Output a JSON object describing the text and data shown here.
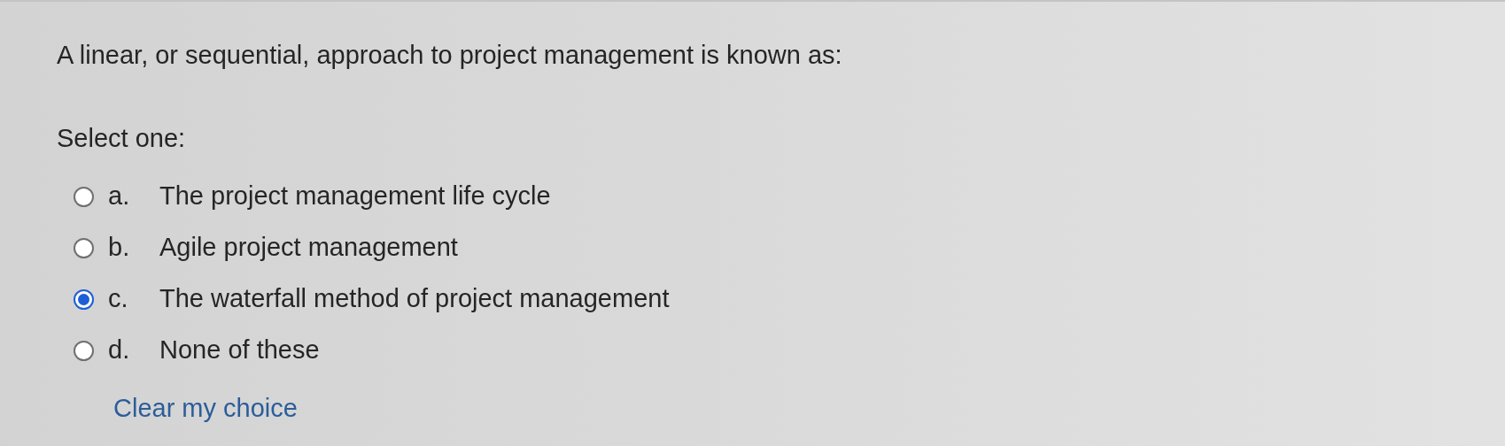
{
  "question": "A linear, or sequential, approach to project management is known as:",
  "prompt": "Select one:",
  "options": [
    {
      "letter": "a.",
      "label": "The project management life cycle",
      "selected": false
    },
    {
      "letter": "b.",
      "label": "Agile project management",
      "selected": false
    },
    {
      "letter": "c.",
      "label": "The waterfall method of project management",
      "selected": true
    },
    {
      "letter": "d.",
      "label": "None of these",
      "selected": false
    }
  ],
  "clear_link": "Clear my choice"
}
